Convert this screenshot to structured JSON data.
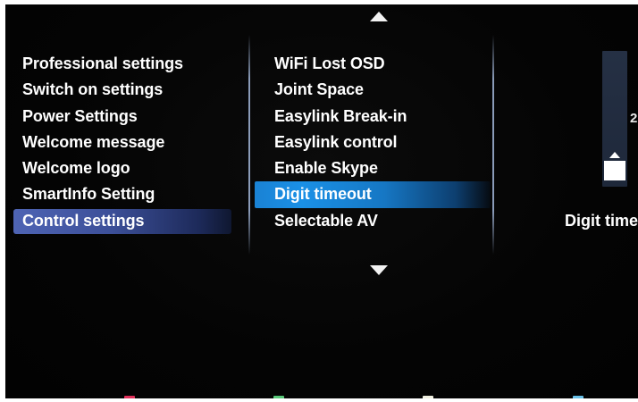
{
  "colors": {
    "left_selection": "#4e64b4",
    "middle_selection": "#1a90e6",
    "key_red": "#e0305a",
    "key_green": "#58c878",
    "key_yellow": "#f0f0e0",
    "key_blue": "#68c0e8"
  },
  "navigation": {
    "up_icon": "triangle-up",
    "down_icon": "triangle-down"
  },
  "left_menu": {
    "items": [
      {
        "label": "Professional settings",
        "selected": false
      },
      {
        "label": "Switch on settings",
        "selected": false
      },
      {
        "label": "Power Settings",
        "selected": false
      },
      {
        "label": "Welcome message",
        "selected": false
      },
      {
        "label": "Welcome logo",
        "selected": false
      },
      {
        "label": "SmartInfo Setting",
        "selected": false
      },
      {
        "label": "Control settings",
        "selected": true
      }
    ]
  },
  "middle_menu": {
    "items": [
      {
        "label": "WiFi Lost OSD",
        "selected": false
      },
      {
        "label": "Joint Space",
        "selected": false
      },
      {
        "label": "Easylink Break-in",
        "selected": false
      },
      {
        "label": "Easylink control",
        "selected": false
      },
      {
        "label": "Enable Skype",
        "selected": false
      },
      {
        "label": "Digit timeout",
        "selected": true
      },
      {
        "label": "Selectable AV",
        "selected": false
      }
    ]
  },
  "right_panel": {
    "slider_value": "2",
    "label": "Digit time"
  }
}
